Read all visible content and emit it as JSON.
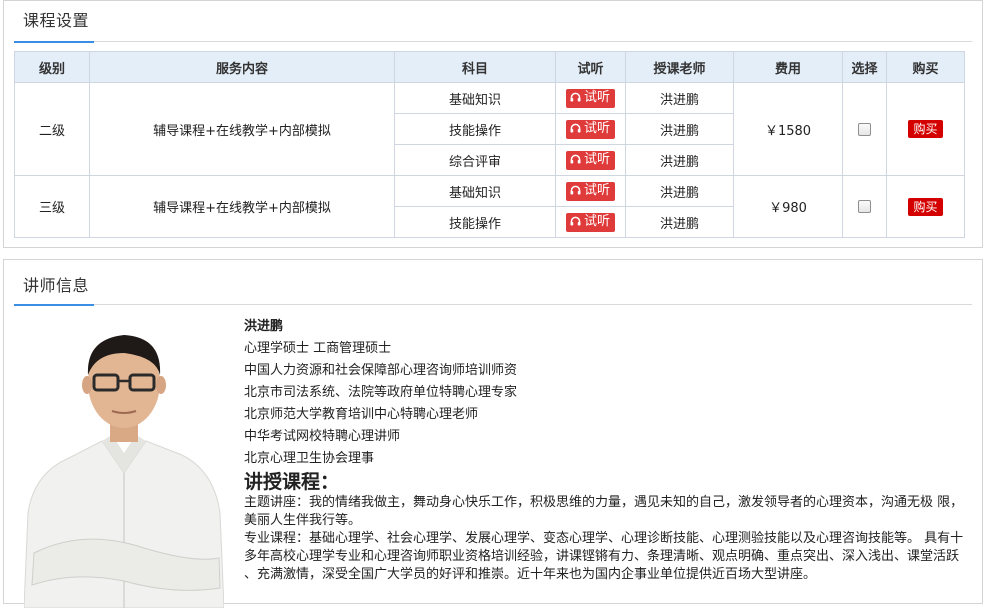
{
  "course_section": {
    "title": "课程设置",
    "columns": [
      "级别",
      "服务内容",
      "科目",
      "试听",
      "授课老师",
      "费用",
      "选择",
      "购买"
    ],
    "trial_label": "试听",
    "buy_label": "购买",
    "levels": [
      {
        "level": "二级",
        "service": "辅导课程+在线教学+内部模拟",
        "fee": "￥1580",
        "subjects": [
          {
            "name": "基础知识",
            "teacher": "洪进鹏"
          },
          {
            "name": "技能操作",
            "teacher": "洪进鹏"
          },
          {
            "name": "综合评审",
            "teacher": "洪进鹏"
          }
        ]
      },
      {
        "level": "三级",
        "service": "辅导课程+在线教学+内部模拟",
        "fee": "￥980",
        "subjects": [
          {
            "name": "基础知识",
            "teacher": "洪进鹏"
          },
          {
            "name": "技能操作",
            "teacher": "洪进鹏"
          }
        ]
      }
    ]
  },
  "teacher_section": {
    "title": "讲师信息",
    "name": "洪进鹏",
    "credentials": [
      "心理学硕士 工商管理硕士",
      "中国人力资源和社会保障部心理咨询师培训师资",
      "北京市司法系统、法院等政府单位特聘心理专家",
      "北京师范大学教育培训中心特聘心理老师",
      "中华考试网校特聘心理讲师",
      "北京心理卫生协会理事"
    ],
    "courses_heading": "讲授课程：",
    "topic_text": "主题讲座：我的情绪我做主，舞动身心快乐工作，积极思维的力量，遇见未知的自己，激发领导者的心理资本，沟通无极 限，美丽人生伴我行等。",
    "professional_text": "专业课程：基础心理学、社会心理学、发展心理学、变态心理学、心理诊断技能、心理测验技能以及心理咨询技能等。 具有十多年高校心理学专业和心理咨询师职业资格培训经验，讲课铿锵有力、条理清晰、观点明确、重点突出、深入浅出、课堂活跃 、充满激情，深受全国广大学员的好评和推崇。近十年来也为国内企事业单位提供近百场大型讲座。"
  },
  "colors": {
    "accent": "#3a8ee6",
    "header_bg": "#e4eef9",
    "trial_red": "#e03b3b",
    "buy_red": "#d40000"
  }
}
